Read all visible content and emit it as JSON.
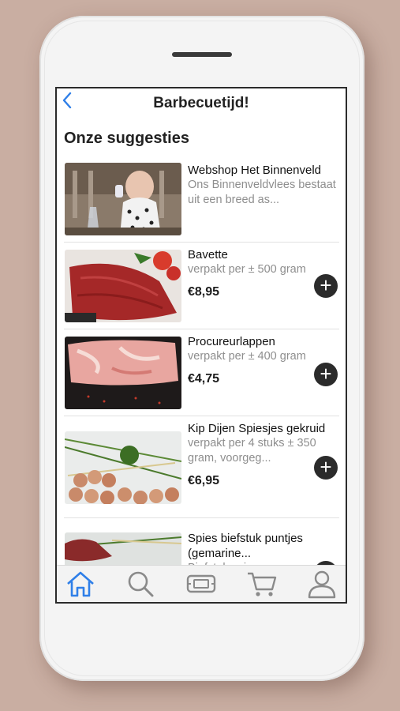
{
  "header": {
    "back_icon": "chevron-left-icon",
    "title": "Barbecuetijd!"
  },
  "section": {
    "title": "Onze suggesties"
  },
  "items": [
    {
      "name": "Webshop Het Binnenveld",
      "desc": "Ons Binnenveldvlees bestaat uit een breed as...",
      "price": "",
      "has_add": false
    },
    {
      "name": "Bavette",
      "desc": "verpakt per ± 500 gram",
      "price": "€8,95",
      "has_add": true
    },
    {
      "name": "Procureurlappen",
      "desc": "verpakt per ± 400 gram",
      "price": "€4,75",
      "has_add": true
    },
    {
      "name": "Kip Dijen Spiesjes gekruid",
      "desc": "verpakt per 4 stuks ± 350 gram, voorgeg...",
      "price": "€6,95",
      "has_add": true
    },
    {
      "name": "Spies biefstuk puntjes (gemarine...",
      "desc": "Biefstuk spiezen per",
      "price": "",
      "has_add": true
    }
  ],
  "tabbar": {
    "tabs": [
      {
        "icon": "home-icon",
        "active": true
      },
      {
        "icon": "search-icon",
        "active": false
      },
      {
        "icon": "ticket-icon",
        "active": false
      },
      {
        "icon": "cart-icon",
        "active": false
      },
      {
        "icon": "profile-icon",
        "active": false
      }
    ],
    "active_color": "#2f7fe8",
    "inactive_color": "#8a8a8a"
  },
  "colors": {
    "accent": "#2f7fe8",
    "background": "#c9aea2"
  }
}
